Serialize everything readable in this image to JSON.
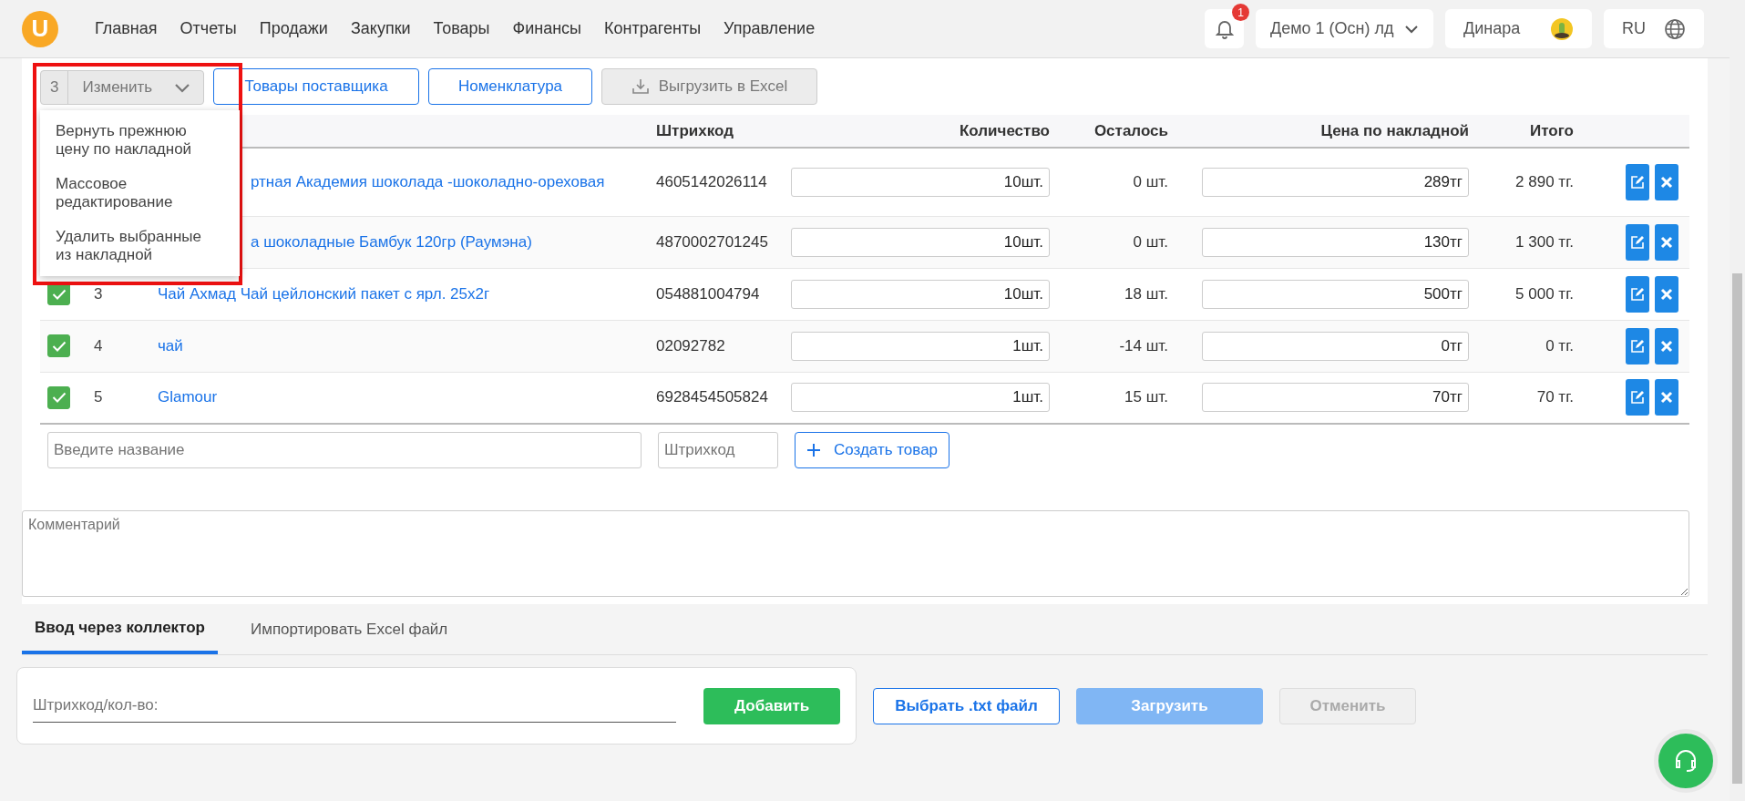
{
  "header": {
    "logo": "U",
    "nav": [
      {
        "label": "Главная"
      },
      {
        "label": "Отчеты"
      },
      {
        "label": "Продажи"
      },
      {
        "label": "Закупки"
      },
      {
        "label": "Товары"
      },
      {
        "label": "Финансы"
      },
      {
        "label": "Контрагенты"
      },
      {
        "label": "Управление"
      }
    ],
    "notifications": "1",
    "store": "Демо 1 (Осн) лд",
    "user": "Динара",
    "language": "RU"
  },
  "toolbar": {
    "selected_count": "3",
    "change_button": "Изменить",
    "buttons": [
      {
        "label": "Товары поставщика",
        "kind": "outline"
      },
      {
        "label": "Номенклатура",
        "kind": "outline"
      },
      {
        "label": "Выгрузить в Excel",
        "kind": "export"
      }
    ]
  },
  "change_menu": {
    "items": [
      "Вернуть прежнюю цену по накладной",
      "Массовое редактирование",
      "Удалить выбранные из накладной"
    ]
  },
  "table": {
    "columns": [
      "Штрихкод",
      "Количество",
      "Осталось",
      "Цена по накладной",
      "Итого"
    ],
    "rows": [
      {
        "name": "ртная Академия шоколада -шоколадно-ореховая",
        "barcode": "4605142026114",
        "quantity": "10шт.",
        "remaining": "0 шт.",
        "price": "289тг",
        "total": "2 890 тг."
      },
      {
        "name": "а шоколадные Бамбук 120гр (Раумэна)",
        "barcode": "4870002701245",
        "quantity": "10шт.",
        "remaining": "0 шт.",
        "price": "130тг",
        "total": "1 300 тг."
      },
      {
        "checked": true,
        "number": "3",
        "name": "Чай Ахмад Чай цейлонский пакет с ярл. 25х2г",
        "barcode": "054881004794",
        "quantity": "10шт.",
        "remaining": "18 шт.",
        "price": "500тг",
        "total": "5 000 тг."
      },
      {
        "checked": true,
        "number": "4",
        "name": "чай",
        "barcode": "02092782",
        "quantity": "1шт.",
        "remaining": "-14 шт.",
        "price": "0тг",
        "total": "0 тг."
      },
      {
        "checked": true,
        "number": "5",
        "name": "Glamour",
        "barcode": "6928454505824",
        "quantity": "1шт.",
        "remaining": "15 шт.",
        "price": "70тг",
        "total": "70 тг."
      }
    ],
    "new_name": {
      "placeholder": "Введите название"
    },
    "new_barcode": {
      "placeholder": "Штрихкод"
    },
    "create_button": "Создать товар"
  },
  "comment": {
    "placeholder": "Комментарий"
  },
  "tabs": [
    {
      "label": "Ввод через коллектор",
      "selected": true
    },
    {
      "label": "Импортировать Excel файл",
      "selected": false
    }
  ],
  "collector": {
    "placeholder": "Штрихкод/кол-во:",
    "add_button": "Добавить"
  },
  "file_buttons": [
    {
      "label": "Выбрать .txt файл",
      "kind": "outline"
    },
    {
      "label": "Загрузить",
      "kind": "primary-disabled"
    },
    {
      "label": "Отменить",
      "kind": "disabled"
    }
  ]
}
